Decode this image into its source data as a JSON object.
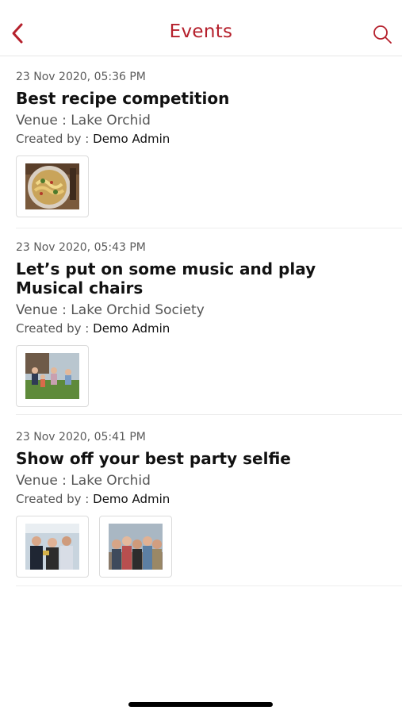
{
  "header": {
    "title": "Events",
    "back_icon": "chevron-left-icon",
    "search_icon": "search-icon",
    "accent": "#b5202c"
  },
  "events": [
    {
      "datetime": "23 Nov 2020, 05:36 PM",
      "title": "Best recipe competition",
      "venue": "Venue : Lake Orchid",
      "created_by_label": "Created by :",
      "created_by_name": "Demo  Admin",
      "photos": [
        "pasta-dish-photo"
      ]
    },
    {
      "datetime": "23 Nov 2020, 05:43 PM",
      "title": "Let’s put on some music and play Musical chairs",
      "venue": "Venue : Lake Orchid Society",
      "created_by_label": "Created by :",
      "created_by_name": "Demo  Admin",
      "photos": [
        "outdoor-party-photo"
      ]
    },
    {
      "datetime": "23 Nov 2020, 05:41 PM",
      "title": "Show off your best party selfie",
      "venue": "Venue : Lake Orchid",
      "created_by_label": "Created by :",
      "created_by_name": "Demo  Admin",
      "photos": [
        "party-group-photo",
        "group-selfie-photo"
      ]
    }
  ]
}
